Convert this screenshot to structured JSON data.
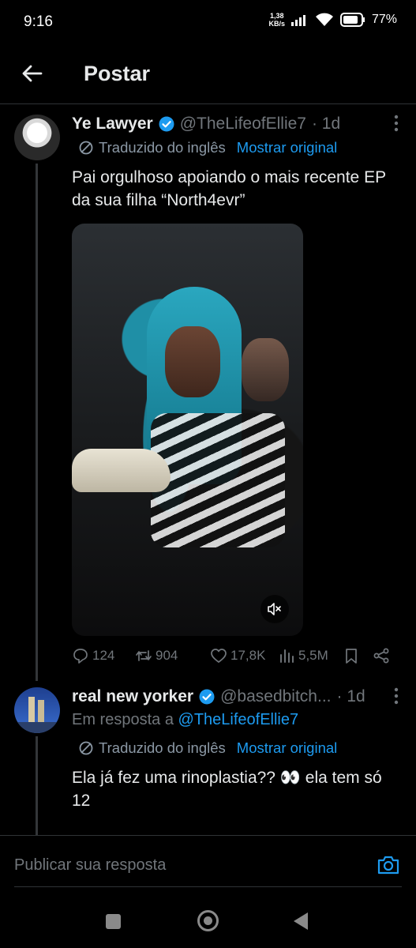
{
  "status_bar": {
    "time": "9:16",
    "net_speed_value": "1,38",
    "net_speed_unit": "KB/s",
    "battery": "77%"
  },
  "header": {
    "title": "Postar"
  },
  "tweet": {
    "display_name": "Ye Lawyer",
    "handle": "@TheLifeofEllie7",
    "time_ago": "· 1d",
    "translated_label": "Traduzido do inglês",
    "show_original": "Mostrar original",
    "text": "Pai orgulhoso apoiando o mais recente EP da sua filha “North4evr”",
    "stats": {
      "replies": "124",
      "retweets": "904",
      "likes": "17,8K",
      "views": "5,5M"
    }
  },
  "reply": {
    "display_name": "real new yorker",
    "handle": "@basedbitch...",
    "time_ago": "· 1d",
    "reply_prefix": "Em resposta a",
    "reply_mention": "@TheLifeofEllie7",
    "translated_label": "Traduzido do inglês",
    "show_original": "Mostrar original",
    "text": "Ela já fez uma rinoplastia?? 👀 ela tem só 12"
  },
  "composer": {
    "placeholder": "Publicar sua resposta"
  },
  "colors": {
    "accent": "#1d9bf0",
    "background": "#000000",
    "muted": "#71767b",
    "text": "#e7e9ea"
  }
}
